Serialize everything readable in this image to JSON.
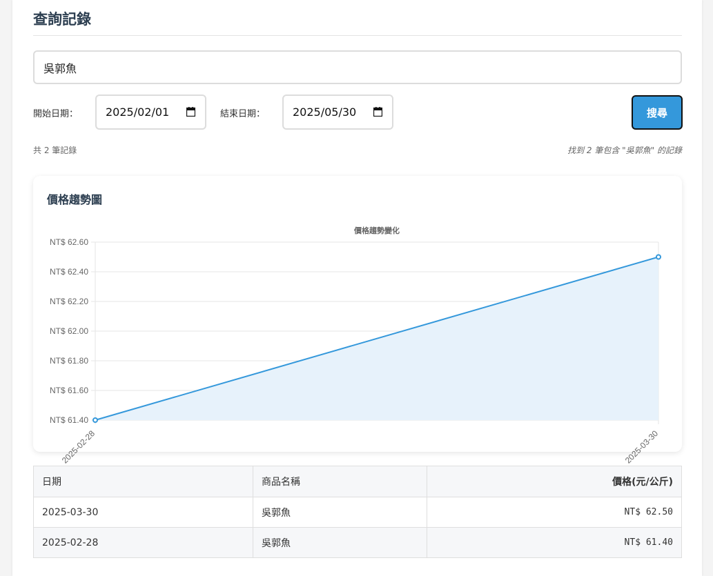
{
  "page": {
    "title": "查詢記錄"
  },
  "search": {
    "value": "吳郭魚"
  },
  "filters": {
    "start_label": "開始日期：",
    "start_value": "2025/02/01",
    "end_label": "結束日期：",
    "end_value": "2025/05/30",
    "search_button": "搜尋"
  },
  "results": {
    "count_text": "共 2 筆記錄",
    "found_text": "找到 2 筆包含 \"吳郭魚\" 的記錄"
  },
  "chart_card": {
    "title": "價格趨勢圖"
  },
  "chart_data": {
    "type": "line",
    "title": "價格趨勢變化",
    "x": [
      "2025-02-28",
      "2025-03-30"
    ],
    "series": [
      {
        "values": [
          61.4,
          62.5
        ]
      }
    ],
    "ylim": [
      61.4,
      62.6
    ],
    "yticks": [
      61.4,
      61.6,
      61.8,
      62.0,
      62.2,
      62.4,
      62.6
    ],
    "y_tick_prefix": "NT$ ",
    "fill": true,
    "grid": true,
    "colors": {
      "line": "#3498db",
      "fill": "#e7f2fb",
      "grid": "#e6e6e6"
    }
  },
  "table": {
    "headers": [
      "日期",
      "商品名稱",
      "價格(元/公斤)"
    ],
    "rows": [
      [
        "2025-03-30",
        "吳郭魚",
        "NT$ 62.50"
      ],
      [
        "2025-02-28",
        "吳郭魚",
        "NT$ 61.40"
      ]
    ]
  },
  "colors": {
    "accent": "#3498db",
    "title": "#2c3e50"
  }
}
